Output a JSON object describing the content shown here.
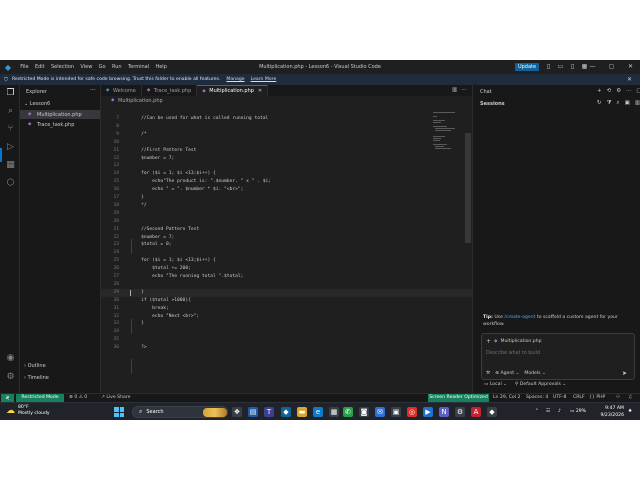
{
  "window": {
    "title": "Multiplication.php - Lesson6 - Visual Studio Code",
    "menu": [
      "File",
      "Edit",
      "Selection",
      "View",
      "Go",
      "Run",
      "Terminal",
      "Help"
    ],
    "update_label": "Update"
  },
  "banner": {
    "message": "Restricted Mode is intended for safe code browsing. Trust this folder to enable all features.",
    "manage": "Manage",
    "learn_more": "Learn More"
  },
  "explorer": {
    "title": "Explorer",
    "folder": "Lesson6",
    "files": [
      "Multiplication.php",
      "Trace_task.php"
    ],
    "outline": "Outline",
    "timeline": "Timeline"
  },
  "tabs": [
    {
      "label": "Welcome"
    },
    {
      "label": "Trace_task.php"
    },
    {
      "label": "Multiplication.php"
    }
  ],
  "breadcrumb": "Multiplication.php",
  "code": {
    "current_line": 29,
    "lines": [
      {
        "n": "7",
        "t": "    //Can be used for what is called running total"
      },
      {
        "n": "8",
        "t": ""
      },
      {
        "n": "9",
        "t": "    /*"
      },
      {
        "n": "10",
        "t": ""
      },
      {
        "n": "11",
        "t": "    //First Pattern Test"
      },
      {
        "n": "12",
        "t": "    $number = 7;"
      },
      {
        "n": "13",
        "t": ""
      },
      {
        "n": "14",
        "t": "    for ($i = 1; $i <13;$i++) {"
      },
      {
        "n": "15",
        "t": "        echo\"The product is: \".$number. \" x \" . $i;"
      },
      {
        "n": "16",
        "t": "        echo \" = \". $number * $i. \"<br>\";"
      },
      {
        "n": "17",
        "t": "    }"
      },
      {
        "n": "18",
        "t": "    */"
      },
      {
        "n": "19",
        "t": ""
      },
      {
        "n": "20",
        "t": ""
      },
      {
        "n": "21",
        "t": "    //Second Pattern Test"
      },
      {
        "n": "22",
        "t": "    $number = 7;"
      },
      {
        "n": "23",
        "t": "    $total = 0;"
      },
      {
        "n": "24",
        "t": ""
      },
      {
        "n": "25",
        "t": "    for ($i = 1; $i <13;$i++) {"
      },
      {
        "n": "26",
        "t": "        $total += 200;"
      },
      {
        "n": "27",
        "t": "        echo \"The running total \".$total;"
      },
      {
        "n": "28",
        "t": ""
      },
      {
        "n": "29",
        "t": "    }"
      },
      {
        "n": "30",
        "t": "    if ($total >1000){"
      },
      {
        "n": "31",
        "t": "        break;"
      },
      {
        "n": "32",
        "t": "        echo \"Next <br>\";"
      },
      {
        "n": "33",
        "t": "    }"
      },
      {
        "n": "34",
        "t": ""
      },
      {
        "n": "35",
        "t": ""
      },
      {
        "n": "36",
        "t": "    ?>"
      }
    ]
  },
  "chat": {
    "title": "Chat",
    "sessions": "Sessions",
    "tip_prefix": "Tip:",
    "tip_use": "Use",
    "tip_link": "/create-agent",
    "tip_rest": "to scaffold a custom agent for your workflow.",
    "attachment": "Multiplication.php",
    "input_placeholder": "Describe what to build",
    "agent": "Agent",
    "models": "Models",
    "local": "Local",
    "approvals": "Default Approvals"
  },
  "statusbar": {
    "restricted": "Restricted Mode",
    "errors": "0",
    "warnings": "0",
    "live_share": "Live Share",
    "screen_reader": "Screen Reader Optimized",
    "position": "Ln 29, Col 2",
    "spaces": "Spaces: 4",
    "encoding": "UTF-8",
    "eol": "CRLF",
    "language": "PHP"
  },
  "taskbar": {
    "temp": "80°F",
    "weather": "Mostly cloudy",
    "search": "Search",
    "battery": "29%",
    "time": "9:47 AM",
    "date": "9/23/2026"
  }
}
